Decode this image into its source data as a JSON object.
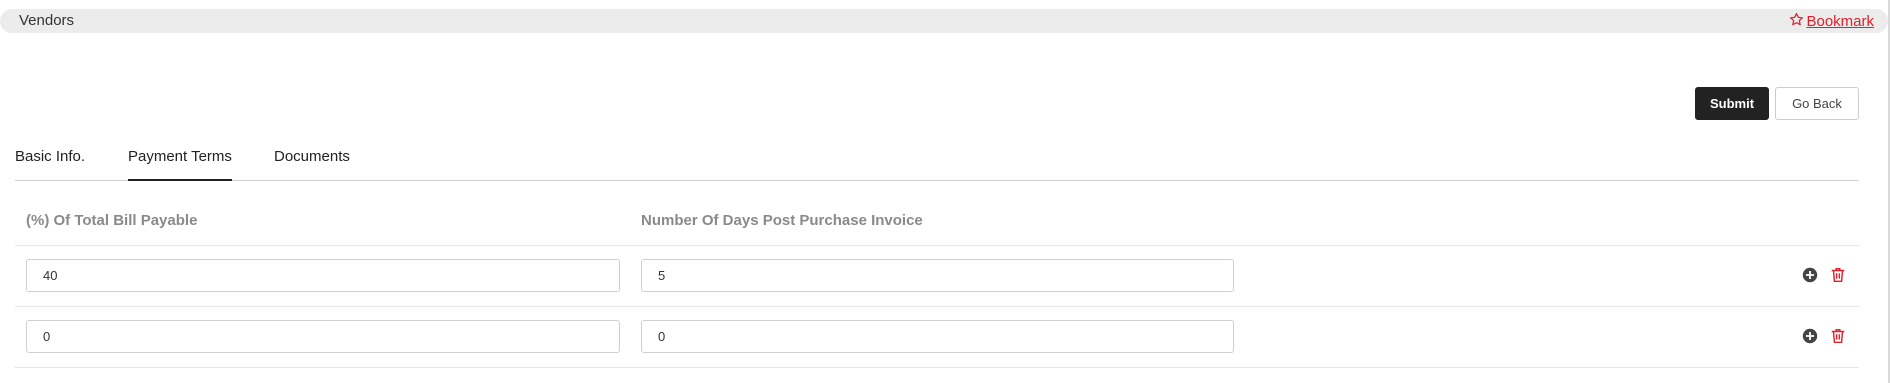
{
  "header": {
    "title": "Vendors",
    "bookmark_label": "Bookmark"
  },
  "actions": {
    "submit_label": "Submit",
    "back_label": "Go Back"
  },
  "tabs": [
    {
      "label": "Basic Info.",
      "active": false
    },
    {
      "label": "Payment Terms",
      "active": true
    },
    {
      "label": "Documents",
      "active": false
    }
  ],
  "table": {
    "columns": [
      "(%) Of Total Bill Payable",
      "Number Of Days Post Purchase Invoice"
    ],
    "rows": [
      {
        "percent": "40",
        "days": "5"
      },
      {
        "percent": "0",
        "days": "0"
      }
    ]
  },
  "icons": {
    "bookmark": "star-outline-icon",
    "add": "plus-circle-icon",
    "delete": "trash-icon"
  },
  "colors": {
    "accent_red": "#e0202b",
    "dark": "#222222"
  }
}
